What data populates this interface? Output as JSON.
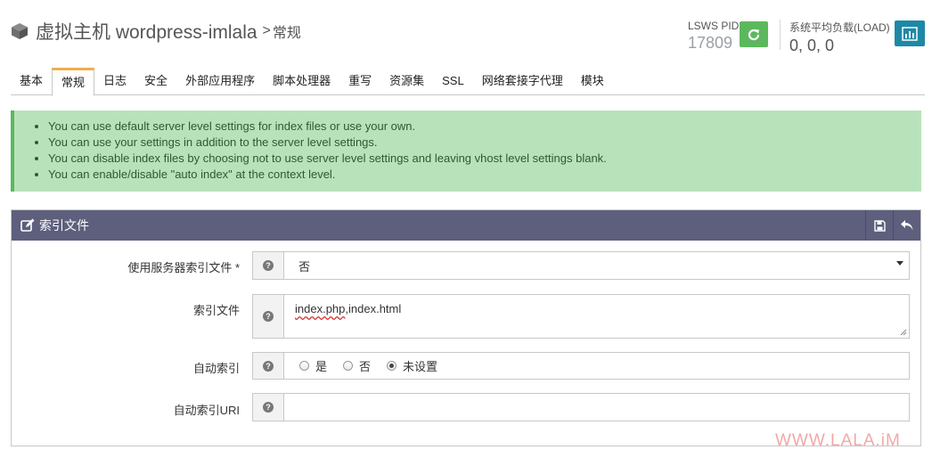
{
  "header": {
    "icon": "cube-icon",
    "title": "虚拟主机 wordpress-imlala",
    "separator": ">",
    "subtitle": "常规",
    "pid_label": "LSWS PID",
    "pid_value": "17809",
    "load_label": "系统平均负载(LOAD)",
    "load_value": "0, 0, 0",
    "colors": {
      "restart": "#5cb85c",
      "load": "#1e88a6"
    }
  },
  "tabs": [
    {
      "label": "基本",
      "active": false
    },
    {
      "label": "常规",
      "active": true
    },
    {
      "label": "日志",
      "active": false
    },
    {
      "label": "安全",
      "active": false
    },
    {
      "label": "外部应用程序",
      "active": false
    },
    {
      "label": "脚本处理器",
      "active": false
    },
    {
      "label": "重写",
      "active": false
    },
    {
      "label": "资源集",
      "active": false
    },
    {
      "label": "SSL",
      "active": false
    },
    {
      "label": "网络套接字代理",
      "active": false
    },
    {
      "label": "模块",
      "active": false
    }
  ],
  "alert": {
    "color": "#b8e3ba",
    "items": [
      "You can use default server level settings for index files or use your own.",
      "You can use your settings in addition to the server level settings.",
      "You can disable index files by choosing not to use server level settings and leaving vhost level settings blank.",
      "You can enable/disable \"auto index\" at the context level."
    ]
  },
  "panel": {
    "title": "索引文件",
    "header_color": "#5d5f7d",
    "fields": {
      "use_server": {
        "label": "使用服务器索引文件 *",
        "value": "否"
      },
      "index_files": {
        "label": "索引文件",
        "value_part1": "index.php",
        "value_part2": ",index.html"
      },
      "auto_index": {
        "label": "自动索引",
        "options": [
          "是",
          "否",
          "未设置"
        ],
        "selected": "未设置"
      },
      "auto_index_uri": {
        "label": "自动索引URI",
        "value": ""
      }
    }
  },
  "watermark": "WWW.LALA.iM"
}
